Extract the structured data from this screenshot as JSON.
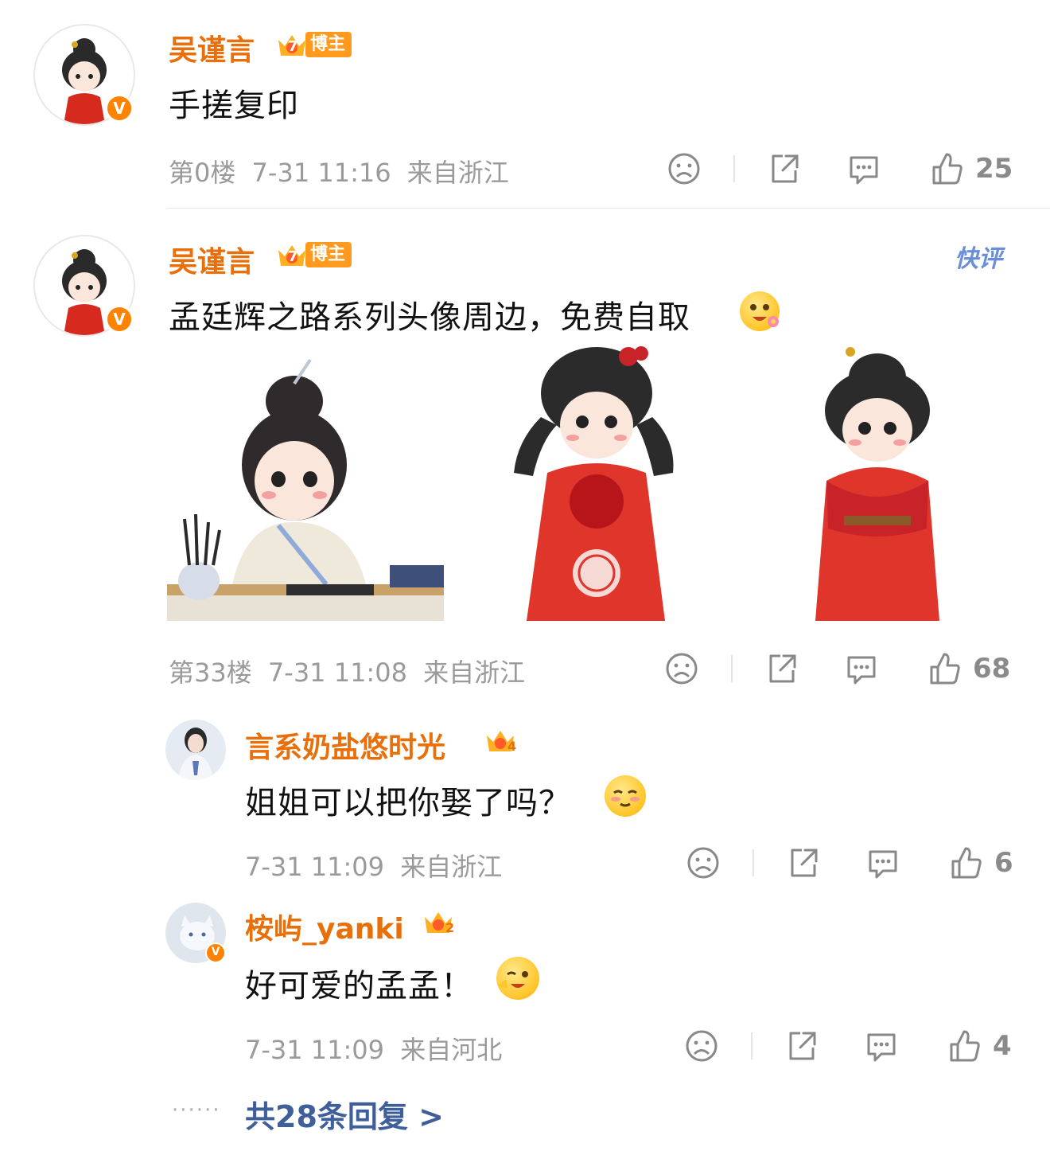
{
  "comments": [
    {
      "username": "吴谨言",
      "badge_level": "7",
      "badge_label": "博主",
      "content": "手搓复印",
      "floor": "第0楼",
      "time": "7-31 11:16",
      "location": "来自浙江",
      "likes": "25"
    },
    {
      "username": "吴谨言",
      "badge_level": "7",
      "badge_label": "博主",
      "content": "孟廷辉之路系列头像周边，免费自取",
      "floor": "第33楼",
      "time": "7-31 11:08",
      "location": "来自浙江",
      "likes": "68",
      "tag": "快评",
      "images": [
        "illustration-writing-desk",
        "illustration-red-robe-pigtails",
        "illustration-red-robe-cape"
      ]
    }
  ],
  "replies": [
    {
      "username": "言系奶盐悠时光",
      "badge_level": "4",
      "content": "姐姐可以把你娶了吗？",
      "time": "7-31 11:09",
      "location": "来自浙江",
      "likes": "6"
    },
    {
      "username": "桉屿_yanki",
      "badge_level": "2",
      "content": "好可爱的孟孟！",
      "time": "7-31 11:09",
      "location": "来自河北",
      "likes": "4"
    }
  ],
  "more_replies": {
    "dots": "······",
    "label": "共28条回复 >"
  },
  "colors": {
    "username": "#e86f0a",
    "verified": "#ff8200",
    "link": "#3f5f9a",
    "meta": "#9a9a9a"
  },
  "icons": [
    "dislike-icon",
    "share-icon",
    "comment-icon",
    "like-icon",
    "verified-icon",
    "crown-icon"
  ]
}
